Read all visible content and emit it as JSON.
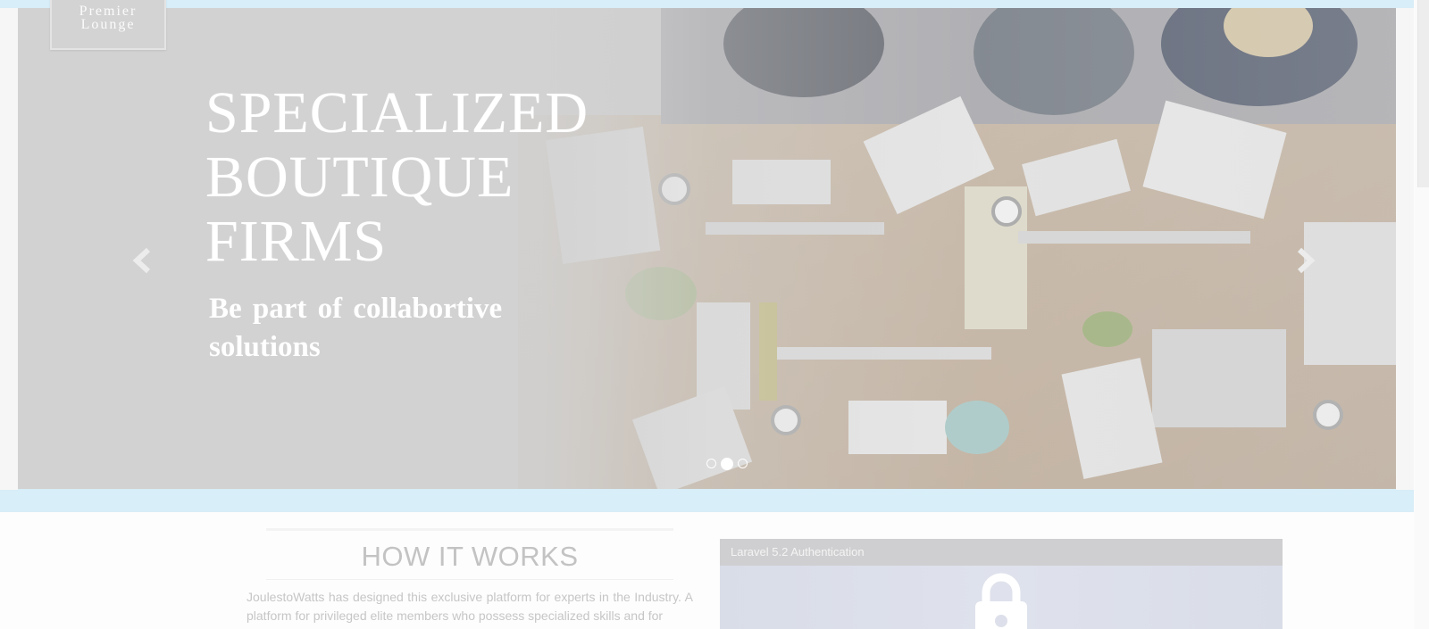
{
  "brand": {
    "line1": "Premier",
    "line2": "Lounge"
  },
  "hero": {
    "title": "SPECIALIZED BOUTIQUE FIRMS",
    "subtitle": "Be part of collabortive solutions",
    "prev_icon": "chevron-left-icon",
    "next_icon": "chevron-right-icon",
    "slides": 3,
    "active_slide": 2
  },
  "how_it_works": {
    "title": "HOW IT WORKS",
    "body": "JoulestoWatts has designed this exclusive platform for experts in the Industry. A platform for privileged elite members who possess specialized skills and for"
  },
  "auth_panel": {
    "header": "Laravel 5.2 Authentication",
    "icon": "lock-icon"
  },
  "colors": {
    "band": "#d8eef8",
    "overlay": "#d2d2d2"
  }
}
